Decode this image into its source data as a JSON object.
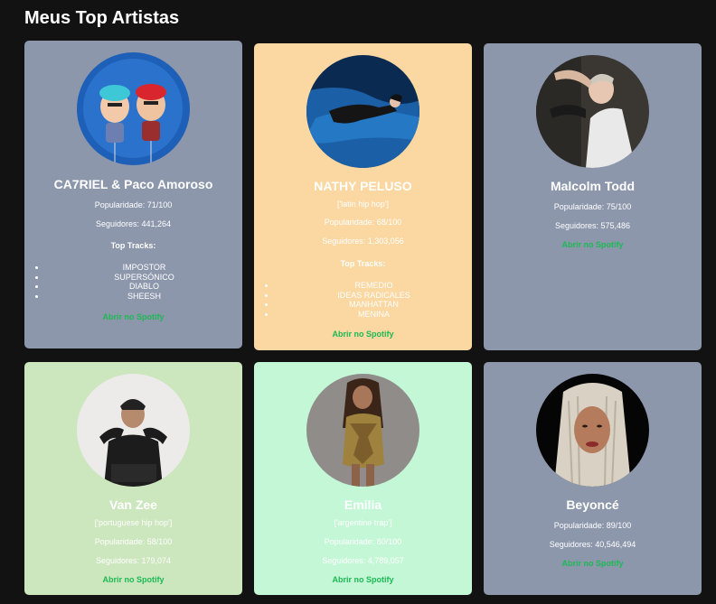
{
  "page": {
    "title": "Meus Top Artistas"
  },
  "labels": {
    "top_tracks": "Top Tracks:",
    "open_spotify": "Abrir no Spotify"
  },
  "artists": [
    {
      "name": "CA7RIEL & Paco Amoroso",
      "popularity": "Popularidade: 71/100",
      "followers": "Seguidores: 441,264",
      "top_tracks": [
        "IMPOSTOR",
        "SUPERSÓNICO",
        "DIABLO",
        "SHEESH"
      ],
      "card_color": "#8c97ac"
    },
    {
      "name": "NATHY PELUSO",
      "genre": "['latin hip hop']",
      "popularity": "Popularidade: 68/100",
      "followers": "Seguidores: 1,303,056",
      "top_tracks": [
        "REMEDIO",
        "IDEAS RADICALES",
        "MANHATTAN",
        "MENINA"
      ],
      "card_color": "#fbd7a1"
    },
    {
      "name": "Malcolm Todd",
      "popularity": "Popularidade: 75/100",
      "followers": "Seguidores: 575,486",
      "card_color": "#8c97ac"
    },
    {
      "name": "Van Zee",
      "genre": "['portuguese hip hop']",
      "popularity": "Popularidade: 58/100",
      "followers": "Seguidores: 179,074",
      "card_color": "#cce6be"
    },
    {
      "name": "Emilia",
      "genre": "['argentine trap']",
      "popularity": "Popularidade: 80/100",
      "followers": "Seguidores: 4,789,057",
      "card_color": "#c4f7d6"
    },
    {
      "name": "Beyoncé",
      "popularity": "Popularidade: 89/100",
      "followers": "Seguidores: 40,546,494",
      "card_color": "#8c97ac"
    }
  ]
}
